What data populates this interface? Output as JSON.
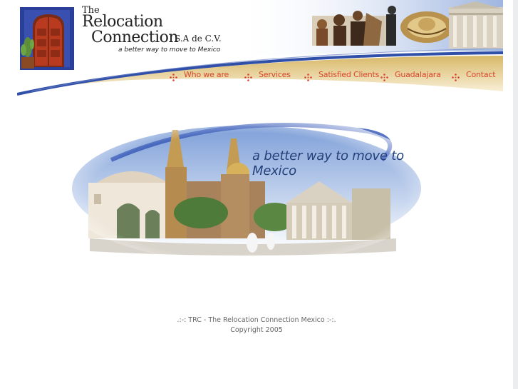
{
  "brand": {
    "the": "The",
    "name_line1": "Relocation",
    "name_line2": "Connection",
    "suffix": "S.A de C.V.",
    "tagline": "a better way to move to Mexico"
  },
  "nav": {
    "items": [
      {
        "label": "Who we are",
        "icon": "ornament-cross-icon"
      },
      {
        "label": "Services",
        "icon": "ornament-cross-icon"
      },
      {
        "label": "Satisfied Clients",
        "icon": "ornament-cross-icon"
      },
      {
        "label": "Guadalajara",
        "icon": "ornament-cross-icon"
      },
      {
        "label": "Contact",
        "icon": "ornament-cross-icon"
      }
    ]
  },
  "banner": {
    "tagline": "a better way to move to Mexico"
  },
  "footer": {
    "line1": ".:-: TRC - The Relocation Connection Mexico :-:.",
    "line2": "Copyright 2005"
  },
  "colors": {
    "nav_text": "#d8452a",
    "swoosh_blue": "#2f4fa8",
    "swoosh_gold": "#c9a24a",
    "door_red": "#b83a1f",
    "logo_blue": "#2a3f9a"
  }
}
